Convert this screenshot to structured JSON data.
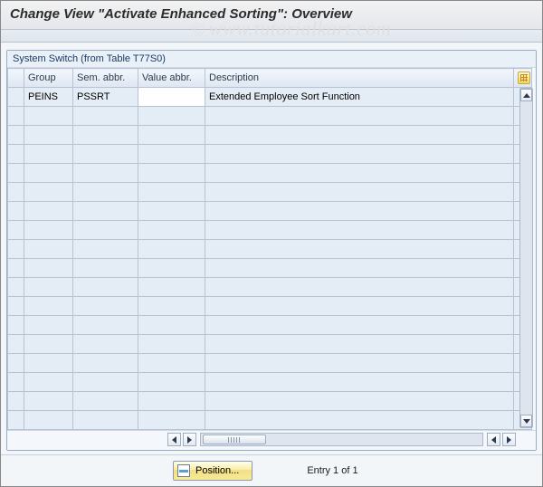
{
  "title": "Change View \"Activate Enhanced Sorting\": Overview",
  "watermark": "www.tutorialkart.com",
  "panel": {
    "caption": "System Switch (from Table T77S0)",
    "columns": {
      "group": "Group",
      "sem": "Sem. abbr.",
      "val": "Value abbr.",
      "desc": "Description"
    },
    "rows": [
      {
        "group": "PEINS",
        "sem": "PSSRT",
        "val": "",
        "desc": "Extended Employee Sort Function"
      }
    ],
    "blankRows": 17
  },
  "footer": {
    "positionLabel": "Position...",
    "entryText": "Entry 1 of 1"
  }
}
